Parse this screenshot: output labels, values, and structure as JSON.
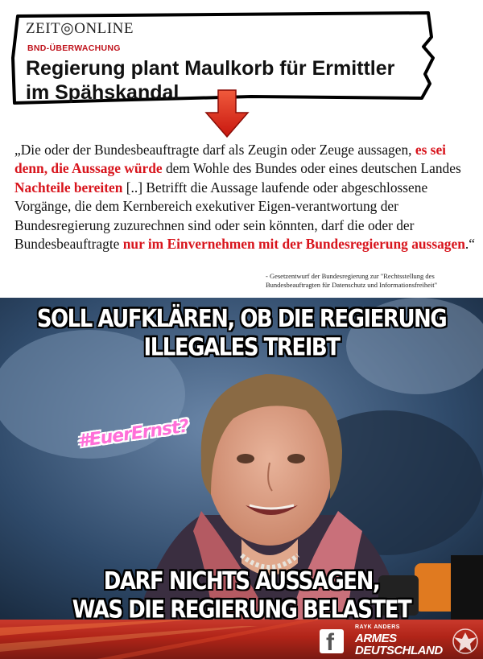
{
  "article": {
    "logo": "ZEIT◎ONLINE",
    "kicker": "BND-ÜBERWACHUNG",
    "headline_line1": "Regierung plant Maulkorb für Ermittler",
    "headline_line2": "im Spähskandal"
  },
  "quote": {
    "part1": "„Die oder der Bundesbeauftragte darf als Zeugin oder Zeuge aussagen, ",
    "hl1": "es sei denn, die Aussage würde",
    "part2": " dem Wohle des Bundes oder eines deutschen Landes ",
    "hl2": "Nachteile bereiten",
    "part3": " [..] Betrifft die Aussage laufende oder abgeschlossene Vorgänge, die dem Kernbereich exekutiver Eigen-verantwortung der Bundesregierung zuzurechnen sind oder sein könnten, darf die oder der Bundesbeauftragte ",
    "hl3": "nur im Einvernehmen mit der Bundesregierung aussagen",
    "part4": ".“",
    "source": "- Gesetzentwurf der Bundesregierung zur \"Rechtsstellung des Bundesbeauftragten für Datenschutz und Informationsfreiheit\""
  },
  "meme": {
    "top_line1": "SOLL AUFKLÄREN, OB DIE REGIERUNG",
    "top_line2": "ILLEGALES TREIBT",
    "hashtag": "#EuerErnst?",
    "bottom_line1": "DARF NICHTS AUSSAGEN,",
    "bottom_line2": "WAS DIE REGIERUNG BELASTET"
  },
  "footer": {
    "fb_icon": "facebook-icon",
    "author": "RAYK ANDERS",
    "brand_line1": "ARMES",
    "brand_line2": "DEUTSCHLAND"
  },
  "colors": {
    "highlight_red": "#d8141c",
    "kicker_red": "#c0141d",
    "hashtag_pink": "#ff6fd8",
    "footer_red": "#b02418"
  }
}
